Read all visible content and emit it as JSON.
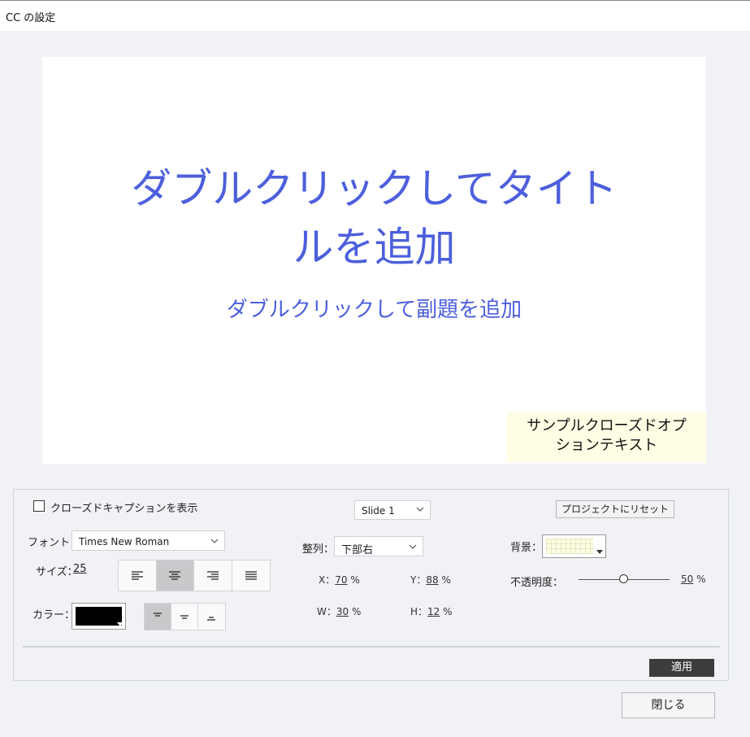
{
  "window": {
    "title": "CC の設定"
  },
  "preview": {
    "title_line1": "ダブルクリックしてタイト",
    "title_line2": "ルを追加",
    "subtitle": "ダブルクリックして副題を追加",
    "caption_text": "サンプルクローズドオプ\nションテキスト"
  },
  "controls": {
    "show_cc_label": "クローズドキャプションを表示",
    "show_cc_checked": false,
    "slide_select": "Slide 1",
    "reset_button": "プロジェクトにリセット",
    "font_label": "フォント：",
    "font_value": "Times New Roman",
    "size_label": "サイズ：",
    "size_value": "25",
    "text_align_options": [
      "left",
      "center",
      "right",
      "justify"
    ],
    "text_align_selected": "center",
    "color_label": "カラー：",
    "color_value": "#000000",
    "vertical_align_options": [
      "top",
      "middle",
      "bottom"
    ],
    "vertical_align_selected": "top",
    "align_label": "整列：",
    "align_value": "下部右",
    "x_label": "X：",
    "x_value": "70",
    "y_label": "Y：",
    "y_value": "88",
    "w_label": "W：",
    "w_value": "30",
    "h_label": "H：",
    "h_value": "12",
    "percent": "%",
    "background_label": "背景：",
    "background_color": "#fffde3",
    "opacity_label": "不透明度：",
    "opacity_value": "50",
    "opacity_fraction": 0.5,
    "apply_button": "適用",
    "close_button": "閉じる"
  },
  "colors": {
    "slide_text": "#4c5fdc",
    "caption_bg": "#fffde3",
    "apply_bg": "#3c3c3c",
    "page_bg": "#f1f2f6"
  }
}
